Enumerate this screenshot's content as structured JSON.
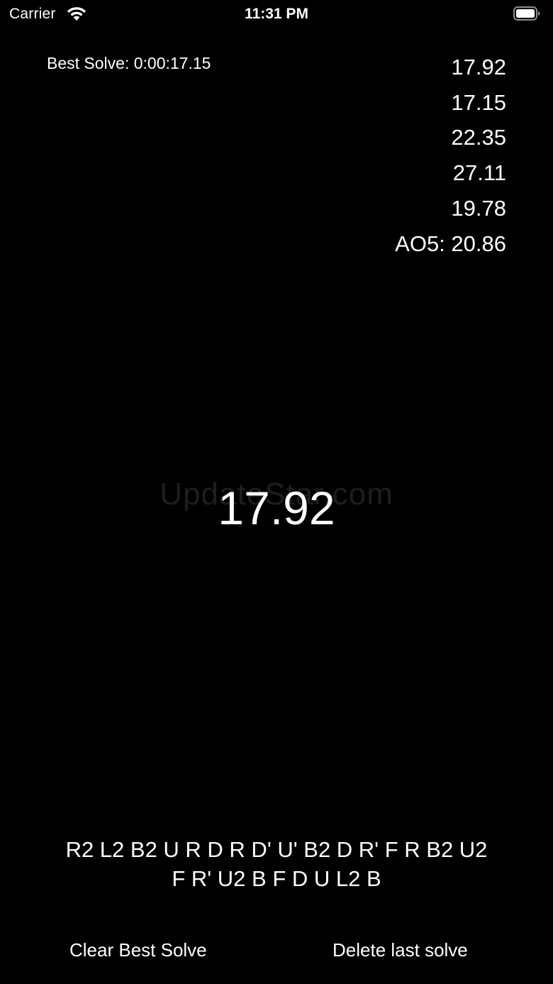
{
  "status_bar": {
    "carrier": "Carrier",
    "time": "11:31 PM",
    "wifi_icon": "wifi-icon",
    "battery_icon": "battery-icon"
  },
  "stats": {
    "best_solve": "Best Solve: 0:00:17.15",
    "recent_solves": [
      "17.92",
      "17.15",
      "22.35",
      "27.11",
      "19.78"
    ],
    "ao5": "AO5: 20.86"
  },
  "timer": {
    "current": "17.92"
  },
  "watermark": "UpdateStar.com",
  "scramble": {
    "line1": "R2 L2 B2 U R D R D' U' B2 D R' F R B2 U2",
    "line2": "F R' U2 B F D U L2 B"
  },
  "buttons": {
    "clear_best": "Clear Best Solve",
    "delete_last": "Delete last solve"
  },
  "colors": {
    "background": "#000000",
    "text": "#ffffff",
    "watermark": "#1e1e1e"
  }
}
